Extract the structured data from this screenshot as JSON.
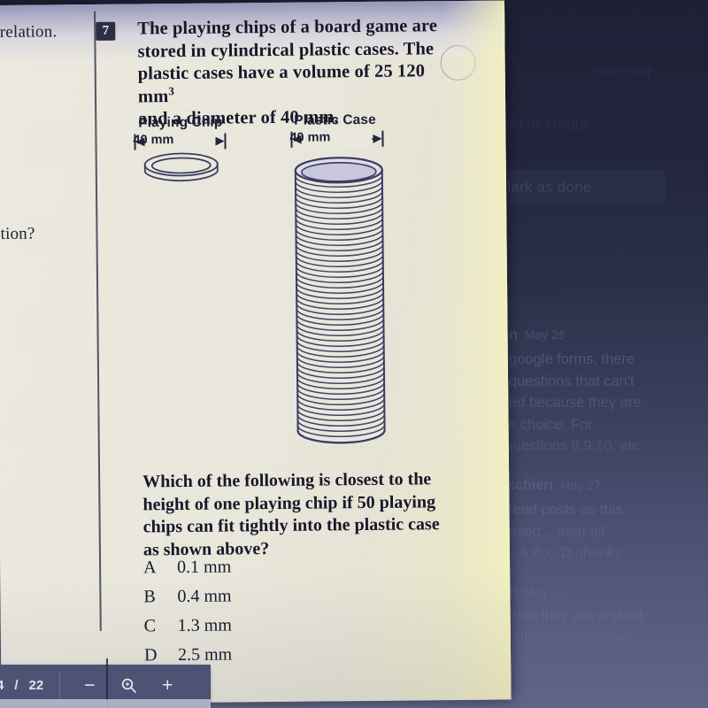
{
  "worksheet": {
    "question_number": "7",
    "stem_line1": "The playing chips of a board game are",
    "stem_line2": "stored in cylindrical plastic cases. The",
    "stem_line3": "plastic cases have a volume of 25 120 mm",
    "stem_exponent": "3",
    "stem_line4": "and a diameter of 40 mm.",
    "figure": {
      "chip_label": "Playing Chip",
      "chip_dimension": "40 mm",
      "case_label": "Plastic Case",
      "case_dimension": "40 mm"
    },
    "tail": "Which of the following is closest to the height of one playing chip if 50 playing chips can fit tightly into the plastic case as shown above?",
    "options": [
      {
        "letter": "A",
        "value": "0.1 mm"
      },
      {
        "letter": "B",
        "value": "0.4 mm"
      },
      {
        "letter": "C",
        "value": "1.3 mm"
      },
      {
        "letter": "D",
        "value": "2.5 mm"
      }
    ],
    "left_column_fragments": {
      "top": "r relation.",
      "middle": "lation?"
    }
  },
  "pdf_toolbar": {
    "current_page": "4",
    "page_separator": "/",
    "total_pages": "22",
    "zoom_out_label": "−",
    "zoom_icon": "magnifier-icon",
    "zoom_in_label": "+"
  },
  "classroom_panel": {
    "status_label": "Assigned",
    "add_or_create_label": "Add or create",
    "mark_as_done_label": "Mark as done",
    "comments_header": "comments",
    "comments": [
      {
        "author": "njan",
        "date": "May 26",
        "text": "he google forms, there\nhe questions that can't\nvered because they are\nuple choice. For\ne, questions 8,9,10, etc"
      },
      {
        "author": "Cuschieri",
        "date": "May 27",
        "text": "se read posts as this\ndressed....treat all\ns as A,B,C,D..thanks"
      },
      {
        "author": "njan",
        "date": "May 27",
        "text": "ant that they are a short\nquestions not multiple"
      }
    ]
  },
  "colors": {
    "paper": "#eae8dc",
    "ink": "#16182a",
    "figure_ink": "#3a3d63",
    "panel_top": "#1e2136",
    "panel_bottom": "#5f6489",
    "toolbar": "#4e5375",
    "glare": "#b3b1cb"
  }
}
